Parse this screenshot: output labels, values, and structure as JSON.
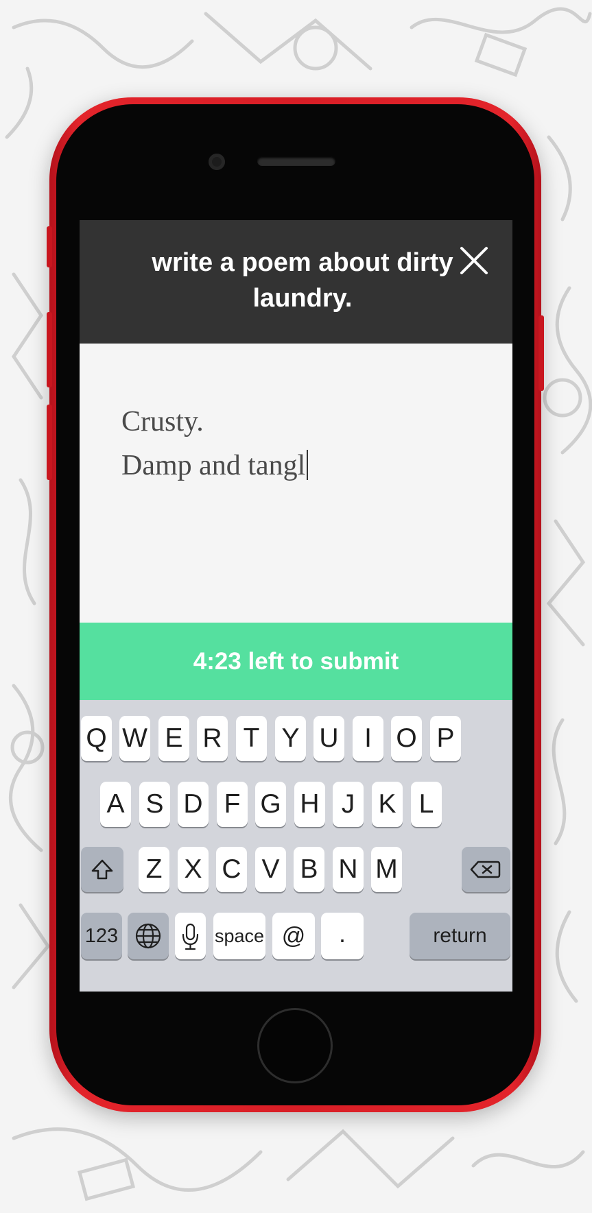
{
  "prompt": {
    "title": "write a poem about dirty laundry.",
    "close_icon": "close-icon"
  },
  "editor": {
    "lines": [
      "Crusty.",
      "Damp and tangl"
    ]
  },
  "timer": {
    "label": "4:23 left to submit",
    "color": "#55e09f"
  },
  "keyboard": {
    "row1": [
      "Q",
      "W",
      "E",
      "R",
      "T",
      "Y",
      "U",
      "I",
      "O",
      "P"
    ],
    "row2": [
      "A",
      "S",
      "D",
      "F",
      "G",
      "H",
      "J",
      "K",
      "L"
    ],
    "row3": [
      "Z",
      "X",
      "C",
      "V",
      "B",
      "N",
      "M"
    ],
    "shift_icon": "shift-icon",
    "delete_icon": "backspace-icon",
    "numbers_label": "123",
    "globe_icon": "globe-icon",
    "mic_icon": "microphone-icon",
    "space_label": "space",
    "at_label": "@",
    "period_label": ".",
    "return_label": "return"
  },
  "colors": {
    "header": "#333333",
    "phone": "#e3242b",
    "keyboard": "#d3d5db"
  }
}
